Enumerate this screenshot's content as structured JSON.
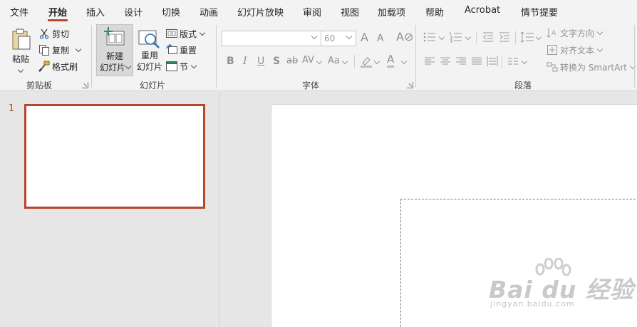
{
  "tabs": [
    {
      "label": "文件",
      "active": false
    },
    {
      "label": "开始",
      "active": true
    },
    {
      "label": "插入",
      "active": false
    },
    {
      "label": "设计",
      "active": false
    },
    {
      "label": "切换",
      "active": false
    },
    {
      "label": "动画",
      "active": false
    },
    {
      "label": "幻灯片放映",
      "active": false
    },
    {
      "label": "审阅",
      "active": false
    },
    {
      "label": "视图",
      "active": false
    },
    {
      "label": "加载项",
      "active": false
    },
    {
      "label": "帮助",
      "active": false
    },
    {
      "label": "Acrobat",
      "active": false
    },
    {
      "label": "情节提要",
      "active": false
    }
  ],
  "clipboard": {
    "paste_label": "粘贴",
    "cut_label": "剪切",
    "copy_label": "复制",
    "format_painter_label": "格式刷",
    "group_label": "剪贴板"
  },
  "slides_group": {
    "new_slide_line1": "新建",
    "new_slide_line2": "幻灯片",
    "reuse_line1": "重用",
    "reuse_line2": "幻灯片",
    "layout_label": "版式",
    "reset_label": "重置",
    "section_label": "节",
    "group_label": "幻灯片"
  },
  "font_group": {
    "font_name_value": "",
    "font_size_value": "60",
    "bold": "B",
    "italic": "I",
    "underline": "U",
    "shadow": "S",
    "strike": "ab",
    "spacing": "AV",
    "change_case": "Aa",
    "font_color": "A",
    "grow": "A",
    "shrink": "A",
    "group_label": "字体"
  },
  "paragraph_group": {
    "text_direction_label": "文字方向",
    "align_text_label": "对齐文本",
    "smartart_label": "转换为 SmartArt",
    "group_label": "段落"
  },
  "thumbnail_pane": {
    "slide_number": "1"
  },
  "colors": {
    "accent": "#b7472a",
    "ribbon_bg": "#f3f3f3",
    "workspace_bg": "#e6e6e6"
  },
  "watermark": {
    "main": "Bai du 经验",
    "sub": "jingyan.baidu.com"
  }
}
